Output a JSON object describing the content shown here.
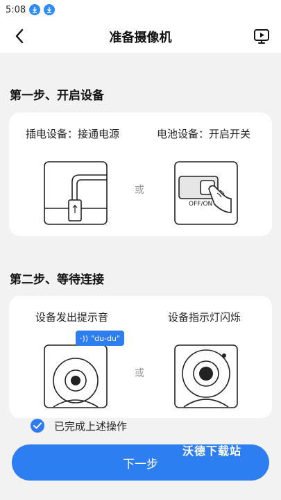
{
  "status_bar": {
    "time": "5:08"
  },
  "header": {
    "title": "准备摄像机"
  },
  "step1": {
    "title": "第一步、开启设备",
    "left_caption": "插电设备：接通电源",
    "right_caption": "电池设备：开启开关",
    "or_text": "或",
    "switch_label": "OFF/ON"
  },
  "step2": {
    "title": "第二步、等待连接",
    "left_caption": "设备发出提示音",
    "right_caption": "设备指示灯闪烁",
    "or_text": "或",
    "sound_bubble": "\"du-du\""
  },
  "confirm": {
    "label": "已完成上述操作",
    "checked": true
  },
  "next_button": {
    "label": "下一步"
  },
  "watermark": {
    "text": "沃德下载站"
  },
  "colors": {
    "accent": "#2d7ef0",
    "background": "#f2f2f2"
  }
}
